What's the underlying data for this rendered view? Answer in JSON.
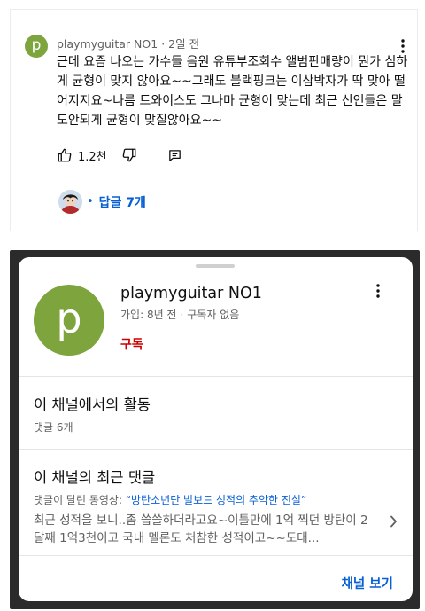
{
  "comment": {
    "avatar_letter": "p",
    "author": "playmyguitar NO1",
    "time": "2일 전",
    "text": "근데 요즘 나오는 가수들 음원 유튜부조회수 앨범판매량이 뭔가 심하게 균형이 맞지 않아요~~그래도 블랙핑크는 이삼박자가 딱 맞아 떨어지지요~나름 트와이스도 그나마 균형이 맞는데 최근 신인들은 말도안되게 균형이 맞질않아요~~",
    "likes": "1.2천",
    "replies_label": "답글 7개"
  },
  "channel_sheet": {
    "avatar_letter": "p",
    "name": "playmyguitar NO1",
    "joined": "가입: 8년 전",
    "subscribers": "구독자 없음",
    "subscribe_label": "구독",
    "activity": {
      "title": "이 채널에서의 활동",
      "count": "댓글 6개"
    },
    "recent": {
      "title": "이 채널의 최근 댓글",
      "video_prefix": "댓글이 달린 동영상:",
      "video_title": "“방탄소년단 빌보드 성적의 추악한 진실”",
      "preview": "최근 성적을 보니..좀 씁쓸하더라고요~이틀만에 1억 찍던 방탄이 2달째 1억3천이고 국내 멜론도 처참한 성적이고~~도대..."
    },
    "view_channel_label": "채널 보기"
  },
  "colors": {
    "link_blue": "#065fd4",
    "subscribe_red": "#cc0000",
    "avatar_green": "#7da43d"
  }
}
